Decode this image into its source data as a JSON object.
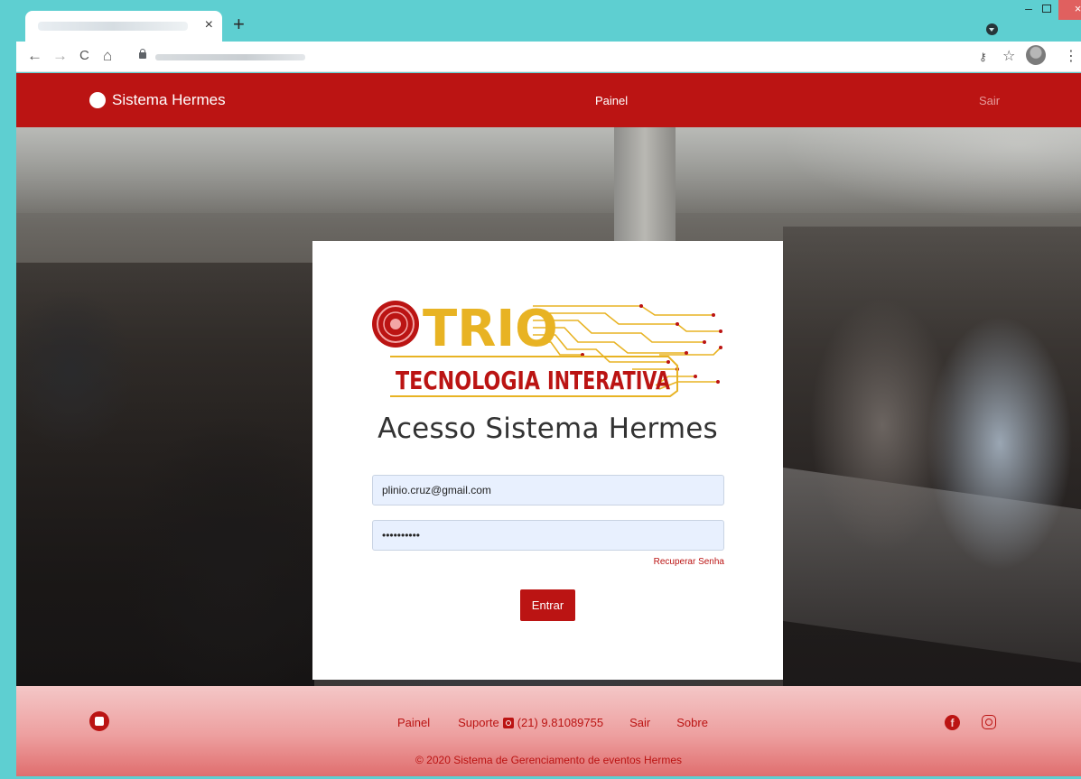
{
  "browser": {
    "tab_close": "×",
    "new_tab": "+",
    "window_min": "–",
    "window_close": "×",
    "toolbar": {
      "back": "←",
      "forward": "→",
      "reload": "C",
      "home": "⌂",
      "star": "☆",
      "menu": "⋮"
    }
  },
  "navbar": {
    "brand": "Sistema Hermes",
    "center_link": "Painel",
    "right_link": "Sair",
    "background_color": "#bb1413"
  },
  "login": {
    "logo_line1": "TRIO",
    "logo_line2_a": "TECNOLOGIA",
    "logo_line2_b": "INTERATIVA",
    "title": "Acesso Sistema Hermes",
    "email_value": "plinio.cruz@gmail.com",
    "password_value": "••••••••••",
    "recover_link": "Recuperar Senha",
    "submit_label": "Entrar"
  },
  "footer": {
    "links": {
      "painel": "Painel",
      "suporte": "Suporte",
      "phone": "(21) 9.81089755",
      "sair": "Sair",
      "sobre": "Sobre"
    },
    "copyright": "© 2020 Sistema de Gerenciamento de eventos Hermes",
    "social": [
      "facebook-icon",
      "instagram-icon"
    ]
  },
  "colors": {
    "accent": "#bb1413",
    "browser_frame": "#5ecfd1",
    "input_bg": "#e8f0fe",
    "logo_gold": "#e8b323"
  }
}
